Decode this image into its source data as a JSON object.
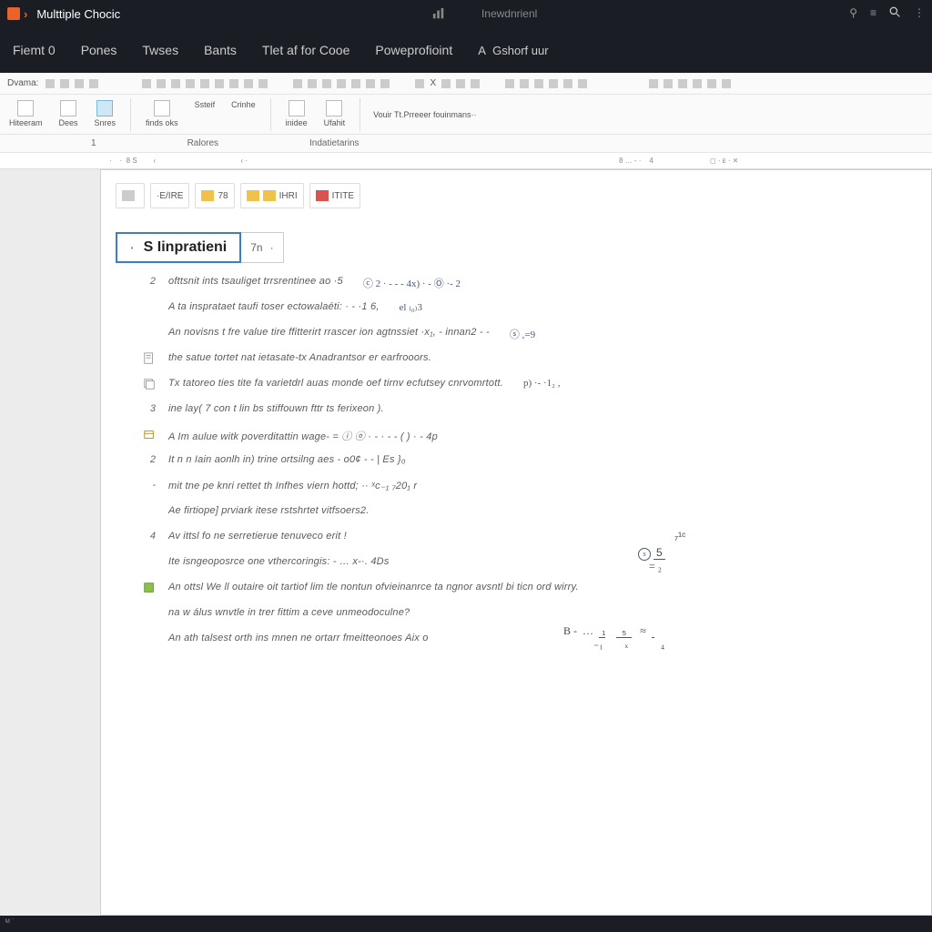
{
  "titlebar": {
    "title": "Multtiple Chocic",
    "center_left": "",
    "center_right": "Inewdnrienl",
    "icons": [
      "chart-icon"
    ]
  },
  "menubar": {
    "items": [
      "Fiemt  0",
      "Pones",
      "Twses",
      "Bants",
      "Tlet af for Cooe",
      "Poweprofioint"
    ],
    "a_label": "A",
    "a_suffix": "Gshorf uur"
  },
  "ribbon": {
    "row1_label": "Dvama:",
    "row2_buttons": [
      {
        "label": "Hiteeram"
      },
      {
        "label": "Dees"
      },
      {
        "label": "Snres"
      },
      {
        "label": "finds oks"
      },
      {
        "label": "Ssteif"
      },
      {
        "label": "Crinhe"
      },
      {
        "label": "inidee"
      },
      {
        "label": "Ufahit"
      }
    ],
    "row2_text": "Vouir Tt.Prreeer  fouinmans··",
    "row3_labels": [
      "Ralores",
      "Indatietarins"
    ]
  },
  "doc_toolbar": {
    "chips": [
      {
        "label": ""
      },
      {
        "label": "E/IRE"
      },
      {
        "label": "78"
      },
      {
        "label": "IHRI"
      },
      {
        "label": "ITITE"
      }
    ]
  },
  "section": {
    "tab1_label": "S Iinpratieni",
    "tab2_label": "7n"
  },
  "lines": [
    {
      "num": "2",
      "text": "ofttsnit ints tsauliget trrsrentinee  ao  ·5",
      "annot": "ⓒ 2 · - - - 4x) · -   Ⓞ ·-  2"
    },
    {
      "num": "",
      "text": "A ta insprataet taufi toser ectowalaéti: ·  - ·1  6,",
      "annot": "el ₍₀₎3"
    },
    {
      "num": "",
      "text": "An novisns t fre value tire ffitterirt rrascer ion agtnssiet ·x₁, - innan2 - -",
      "annot": "ⓢ ,=9"
    },
    {
      "num": "",
      "icon": "page-icon",
      "text": "the satue tortet nat ietasate-tx Anadrantsor er earfrooors.",
      "annot": ""
    },
    {
      "num": "",
      "icon": "stack-icon",
      "text": "Tx  tatoreo ties tite fa varietdrl auas monde oef tirnv ecfutsey cnrvomrtott.",
      "annot": "p)  ·- ·1₂ ,"
    },
    {
      "num": "3",
      "text": "ine lay( 7 con t lin bs stiffouwn fttr ts ferixeon ).",
      "annot": ""
    },
    {
      "num": "",
      "icon": "box-icon",
      "text": "A Im aulue witk poverditattin wage- =  ⓘ ⓞ · - · -  -  ( )  · -  4p",
      "annot": ""
    },
    {
      "num": "2",
      "text": "It n n Iain aonlh  in) trine ortsilng aes -  o0¢  -  -  | Es }₀",
      "annot": ""
    },
    {
      "num": "-",
      "text": "mit tne pe knri rettet th Infhes viern hottd;   ·· ˣc₋₁  ₇20₁  r",
      "annot": ""
    },
    {
      "num": "",
      "text": "Ae firtiope] prviark itese rstshrtet vitfsoers2.",
      "annot": ""
    },
    {
      "num": "4",
      "text": "Av  ittsl fo ne serretierue tenuveco erit !",
      "annot": ""
    },
    {
      "num": "",
      "text": "Ite  isngeoposrce one vthercoringis: -  … x-·.    4Ds",
      "annot": ""
    },
    {
      "num": "",
      "icon": "green-icon",
      "text": "An  ottsl We ll outaire oit tartiof lim tle nontun ofvieinanrce ta ngnor avsntl bi ticn ord wirry.",
      "annot": ""
    },
    {
      "num": "",
      "text": "na w álus wnvtle in trer fittim a ceve unmeodoculne?",
      "annot": ""
    },
    {
      "num": "",
      "text": "An  ath talsest orth ins mnen ne ortarr fmeitteonoes   Aix o",
      "annot": ""
    }
  ],
  "handwriting": {
    "frac_right": "₇¹′\n  5\n  = ₂",
    "eq_bottom": "B -  … ₋₁   ₂     ₅\n        ₋₁   ₍ₓ₎   ≈  ₋₄"
  },
  "pager": {
    "label": "x"
  }
}
